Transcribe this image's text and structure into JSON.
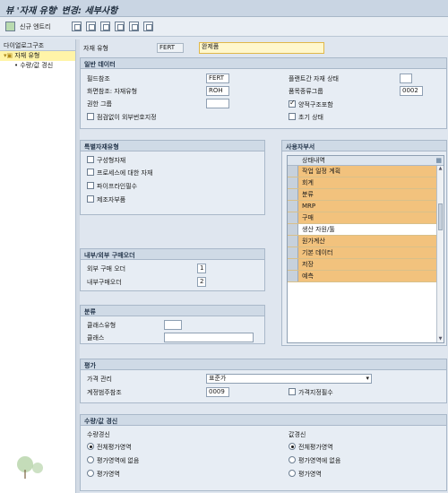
{
  "window": {
    "title": "뷰 '자재 유형' 변경: 세부사항"
  },
  "toolbar": {
    "new_entries_label": "신규 엔트리"
  },
  "dialog_structure": {
    "title": "다이얼로그구조",
    "items": [
      {
        "label": "자재 유형"
      },
      {
        "label": "수량/값 경신"
      }
    ]
  },
  "header": {
    "material_type_label": "자재 유형",
    "material_type_value": "FERT",
    "material_type_desc": "완제품"
  },
  "general_data": {
    "title": "일반 데이터",
    "field_ref_label": "필드참조",
    "field_ref_value": "FERT",
    "screen_ref_label": "화면참조: 자재유형",
    "screen_ref_value": "ROH",
    "auth_group_label": "권한 그룹",
    "auth_group_value": "",
    "ext_no_label": "점검없이 외부번호지정",
    "cross_plant_label": "플랜트간 자재 상태",
    "cross_plant_value": "",
    "item_cat_group_label": "품목종류그룹",
    "item_cat_group_value": "0002",
    "with_qty_struct_label": "양적구조포함",
    "init_status_label": "초기 상태"
  },
  "special_material": {
    "title": "특별자재유형",
    "items": [
      {
        "label": "구성형자재"
      },
      {
        "label": "프로세스에 대한 자재"
      },
      {
        "label": "파이프라인필수"
      },
      {
        "label": "제조자부품"
      }
    ]
  },
  "user_department": {
    "title": "사용자부서",
    "table_header": "상태내역",
    "rows": [
      {
        "label": "작업 일정 계획",
        "highlighted": true
      },
      {
        "label": "회계",
        "highlighted": true
      },
      {
        "label": "분류",
        "highlighted": true
      },
      {
        "label": "MRP",
        "highlighted": true
      },
      {
        "label": "구매",
        "highlighted": true
      },
      {
        "label": "생산 자원/툴",
        "highlighted": false
      },
      {
        "label": "원가계산",
        "highlighted": true
      },
      {
        "label": "기본 데이터",
        "highlighted": true
      },
      {
        "label": "저장",
        "highlighted": true
      },
      {
        "label": "예측",
        "highlighted": true
      }
    ]
  },
  "po": {
    "title": "내부/외부 구매오더",
    "ext_po_label": "외부 구매 오더",
    "ext_po_value": "1",
    "int_po_label": "내부구매오더",
    "int_po_value": "2"
  },
  "classification": {
    "title": "분류",
    "class_type_label": "클래스유형",
    "class_type_value": "",
    "class_label": "클래스",
    "class_value": ""
  },
  "valuation": {
    "title": "평가",
    "price_control_label": "가격 관리",
    "price_control_value": "표준가",
    "acct_cat_ref_label": "계정범주참조",
    "acct_cat_ref_value": "0009",
    "price_ctrl_mandatory_label": "가격지정필수"
  },
  "qty_value_update": {
    "title": "수량/값 경신",
    "qty_label": "수량경신",
    "value_label": "값경신",
    "options": [
      {
        "label": "전체평가영역"
      },
      {
        "label": "평가영역에 없음"
      },
      {
        "label": "평가영역"
      }
    ]
  },
  "colors": {
    "highlight": "#f2c27d",
    "header_bg": "#cfdae6",
    "background": "#dfe6ef",
    "required_field": "#fff7cc"
  }
}
